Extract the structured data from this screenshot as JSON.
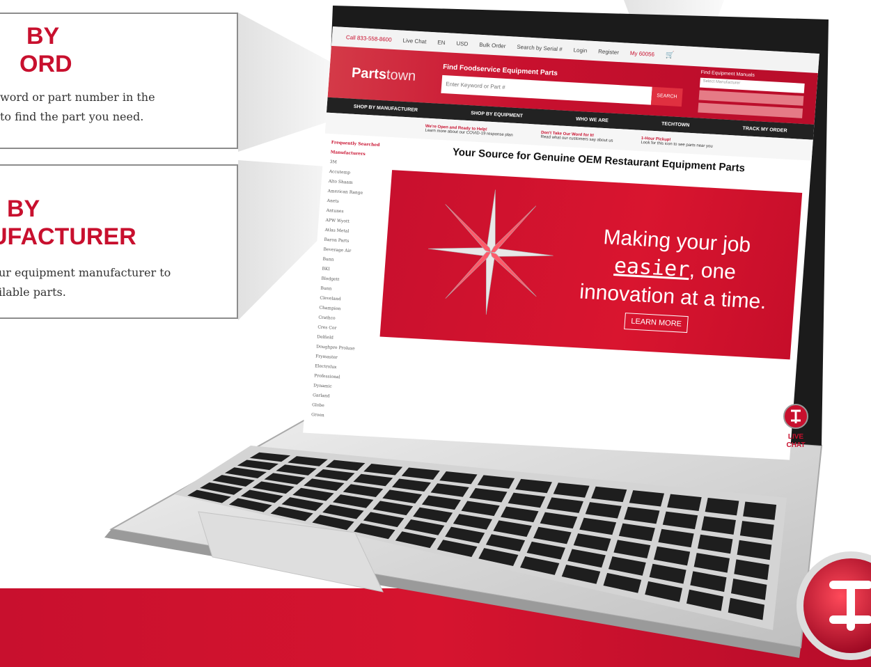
{
  "callouts": {
    "keyword": {
      "heading_line1": "BY",
      "heading_line2": "ORD",
      "body_line1": "word or part number in the",
      "body_line2": "to find the part you need."
    },
    "manufacturer": {
      "heading_line1": "BY",
      "heading_line2": "UFACTURER",
      "body_line1": "ur equipment manufacturer to",
      "body_line2": "ilable parts."
    }
  },
  "site": {
    "topbar": {
      "phone": "Call 833-558-8600",
      "live_chat": "Live Chat",
      "language": "EN",
      "currency": "USD",
      "bulk_order": "Bulk Order",
      "search_serial": "Search by Serial #",
      "login": "Login",
      "register": "Register",
      "location": "My 60056"
    },
    "logo": {
      "brand": "Parts",
      "brand_suffix": "town"
    },
    "finder": {
      "label": "Find Foodservice Equipment Parts",
      "placeholder": "Enter Keyword or Part #",
      "search_label": "SEARCH"
    },
    "mfr_finder": {
      "label": "Find Equipment Manuals",
      "select_placeholder": "Select Manufacturer"
    },
    "nav": [
      "SHOP BY MANUFACTURER",
      "SHOP BY EQUIPMENT",
      "WHO WE ARE",
      "TECHTOWN",
      "TRACK MY ORDER"
    ],
    "promos": [
      {
        "title": "We're Open and Ready to Help!",
        "sub": "Learn more about our COVID-19 response plan"
      },
      {
        "title": "Don't Take Our Word for It!",
        "sub": "Read what our customers say about us"
      },
      {
        "title": "1-Hour Pickup!",
        "sub": "Look for this icon to see parts near you"
      }
    ],
    "sidebar": {
      "title": "Frequently Searched Manufacturers",
      "items": [
        "3M",
        "Accutemp",
        "Alto Shaam",
        "American Range",
        "Anets",
        "Antunes",
        "APW Wyott",
        "Atlas Metal",
        "Baron Parts",
        "Beverage Air",
        "Bunn",
        "BKI",
        "Blodgett",
        "Bunn",
        "Cleveland",
        "Champion",
        "Crathco",
        "Cres Cor",
        "Delfield",
        "Doughpro Proluxe",
        "Frymaster",
        "Electrolux Professional",
        "Dynamic",
        "Garland",
        "Globe",
        "Groen"
      ]
    },
    "main_title": "Your Source for Genuine OEM Restaurant Equipment Parts",
    "banner": {
      "line1": "Making your job",
      "easier": "easier",
      "line2_rest": ", one",
      "line3": "innovation at a time.",
      "cta": "LEARN MORE"
    },
    "live_chat_widget": {
      "line1": "LIVE",
      "line2": "CHAT"
    }
  },
  "colors": {
    "brand_red": "#c8102e",
    "dark_nav": "#222222"
  }
}
